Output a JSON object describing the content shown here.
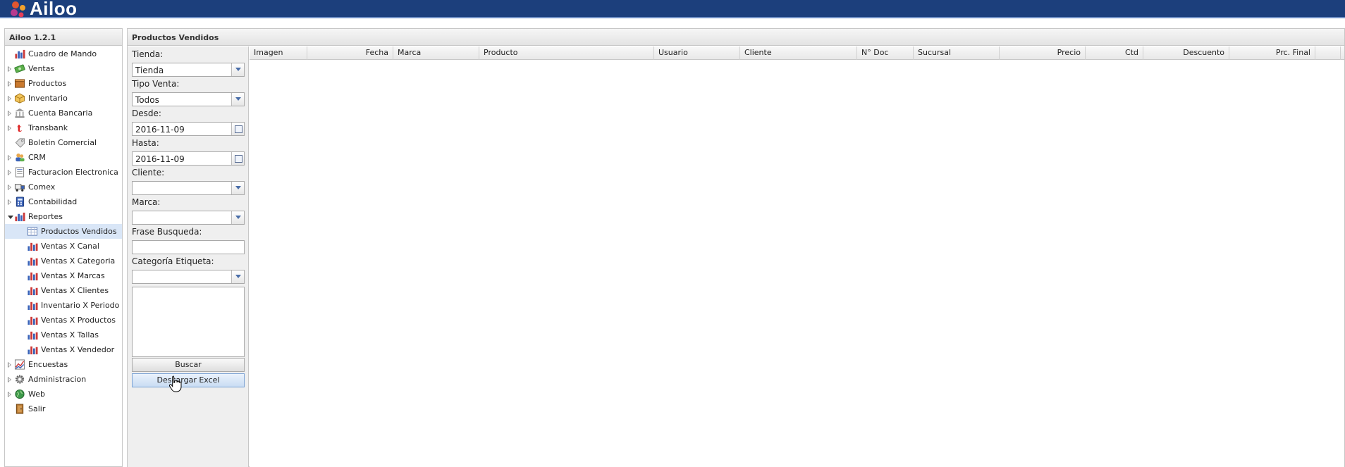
{
  "app": {
    "brand": "Ailoo",
    "version_label": "Ailoo 1.2.1"
  },
  "colors": {
    "header": "#1c3f7c",
    "selected": "#d9e6f7",
    "chart_icon_blue": "#3a62b8",
    "chart_icon_red": "#cc3a3a"
  },
  "sidebar": {
    "items": [
      {
        "label": "Cuadro de Mando",
        "icon": "dashboard-chart-icon",
        "expander": "none",
        "level": 0
      },
      {
        "label": "Ventas",
        "icon": "money-icon",
        "expander": "closed",
        "level": 0
      },
      {
        "label": "Productos",
        "icon": "box-icon",
        "expander": "closed",
        "level": 0
      },
      {
        "label": "Inventario",
        "icon": "package-icon",
        "expander": "closed",
        "level": 0
      },
      {
        "label": "Cuenta Bancaria",
        "icon": "bank-icon",
        "expander": "closed",
        "level": 0
      },
      {
        "label": "Transbank",
        "icon": "transbank-icon",
        "expander": "closed",
        "level": 0
      },
      {
        "label": "Boletin Comercial",
        "icon": "tag-icon",
        "expander": "none",
        "level": 0
      },
      {
        "label": "CRM",
        "icon": "users-icon",
        "expander": "closed",
        "level": 0
      },
      {
        "label": "Facturacion Electronica",
        "icon": "invoice-icon",
        "expander": "closed",
        "level": 0
      },
      {
        "label": "Comex",
        "icon": "truck-icon",
        "expander": "closed",
        "level": 0
      },
      {
        "label": "Contabilidad",
        "icon": "calculator-icon",
        "expander": "closed",
        "level": 0
      },
      {
        "label": "Reportes",
        "icon": "reports-chart-icon",
        "expander": "open",
        "level": 0
      },
      {
        "label": "Productos Vendidos",
        "icon": "table-icon",
        "expander": "none",
        "level": 1,
        "selected": true
      },
      {
        "label": "Ventas X Canal",
        "icon": "bar-chart-icon",
        "expander": "none",
        "level": 1
      },
      {
        "label": "Ventas X Categoria",
        "icon": "bar-chart-icon",
        "expander": "none",
        "level": 1
      },
      {
        "label": "Ventas X Marcas",
        "icon": "bar-chart-icon",
        "expander": "none",
        "level": 1
      },
      {
        "label": "Ventas X Clientes",
        "icon": "bar-chart-icon",
        "expander": "none",
        "level": 1
      },
      {
        "label": "Inventario X Periodo",
        "icon": "bar-chart-icon",
        "expander": "none",
        "level": 1
      },
      {
        "label": "Ventas X Productos",
        "icon": "bar-chart-icon",
        "expander": "none",
        "level": 1
      },
      {
        "label": "Ventas X Tallas",
        "icon": "bar-chart-icon",
        "expander": "none",
        "level": 1
      },
      {
        "label": "Ventas X Vendedor",
        "icon": "bar-chart-icon",
        "expander": "none",
        "level": 1
      },
      {
        "label": "Encuestas",
        "icon": "survey-chart-icon",
        "expander": "closed",
        "level": 0
      },
      {
        "label": "Administracion",
        "icon": "gear-icon",
        "expander": "closed",
        "level": 0
      },
      {
        "label": "Web",
        "icon": "globe-icon",
        "expander": "closed",
        "level": 0
      },
      {
        "label": "Salir",
        "icon": "exit-door-icon",
        "expander": "none",
        "level": 0
      }
    ]
  },
  "main": {
    "title": "Productos Vendidos",
    "form": {
      "tienda_label": "Tienda:",
      "tienda_value": "Tienda",
      "tipo_venta_label": "Tipo Venta:",
      "tipo_venta_value": "Todos",
      "desde_label": "Desde:",
      "desde_value": "2016-11-09",
      "hasta_label": "Hasta:",
      "hasta_value": "2016-11-09",
      "cliente_label": "Cliente:",
      "cliente_value": "",
      "marca_label": "Marca:",
      "marca_value": "",
      "frase_label": "Frase Busqueda:",
      "frase_value": "",
      "categoria_label": "Categoría Etiqueta:",
      "categoria_value": "",
      "buscar_label": "Buscar",
      "excel_label": "Descargar Excel"
    },
    "grid": {
      "columns": [
        {
          "label": "Imagen",
          "align": "left"
        },
        {
          "label": "Fecha",
          "align": "right"
        },
        {
          "label": "Marca",
          "align": "left"
        },
        {
          "label": "Producto",
          "align": "left"
        },
        {
          "label": "Usuario",
          "align": "left"
        },
        {
          "label": "Cliente",
          "align": "left"
        },
        {
          "label": "N° Doc",
          "align": "left"
        },
        {
          "label": "Sucursal",
          "align": "left"
        },
        {
          "label": "Precio",
          "align": "right"
        },
        {
          "label": "Ctd",
          "align": "right"
        },
        {
          "label": "Descuento",
          "align": "right"
        },
        {
          "label": "Prc. Final",
          "align": "right"
        }
      ],
      "rows": []
    }
  }
}
